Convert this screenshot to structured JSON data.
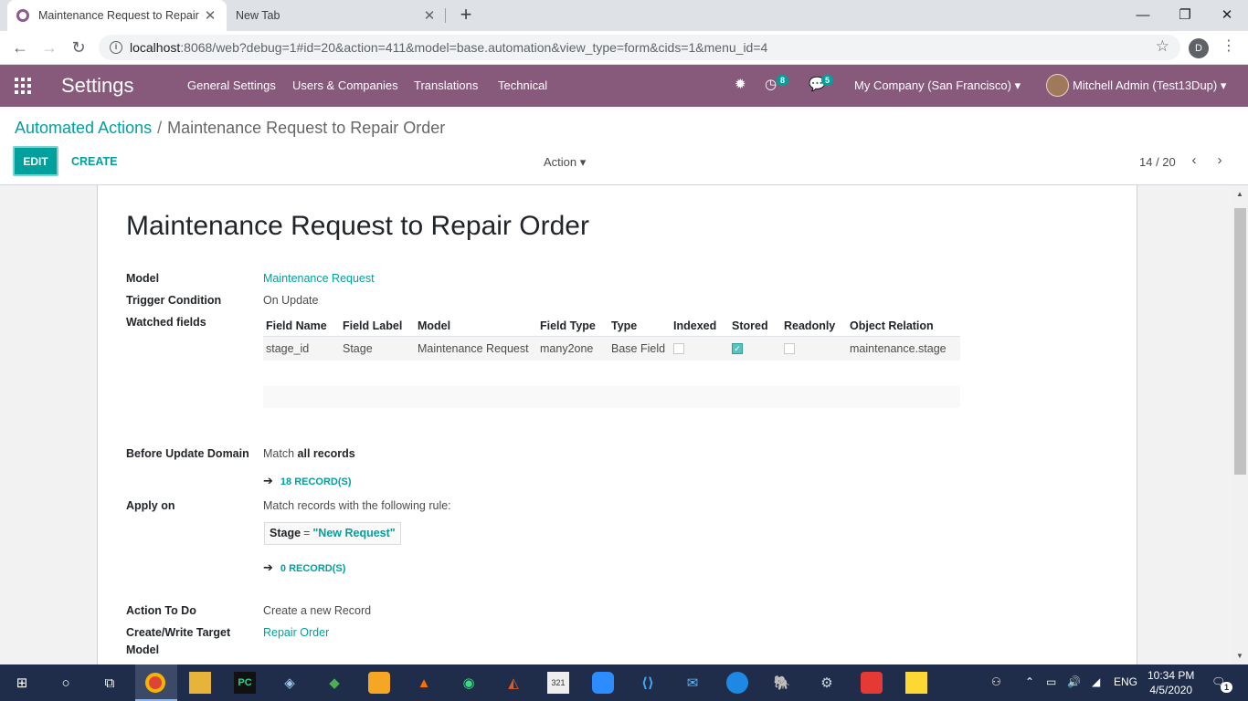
{
  "browser": {
    "active_tab_title": "Maintenance Request to Repair O",
    "inactive_tab_title": "New Tab",
    "url_host": "localhost",
    "url_rest": ":8068/web?debug=1#id=20&action=411&model=base.automation&view_type=form&cids=1&menu_id=4",
    "profile_initial": "D"
  },
  "navbar": {
    "brand": "Settings",
    "menus": [
      "General Settings",
      "Users & Companies",
      "Translations",
      "Technical"
    ],
    "activity_count": "8",
    "message_count": "5",
    "company": "My Company (San Francisco)",
    "user": "Mitchell Admin (Test13Dup)"
  },
  "control_panel": {
    "breadcrumb_parent": "Automated Actions",
    "breadcrumb_current": "Maintenance Request to Repair Order",
    "edit_label": "EDIT",
    "create_label": "CREATE",
    "action_label": "Action",
    "pager": "14 / 20"
  },
  "form": {
    "title": "Maintenance Request to Repair Order",
    "model_label": "Model",
    "model_value": "Maintenance Request",
    "trigger_label": "Trigger Condition",
    "trigger_value": "On Update",
    "watched_label": "Watched fields",
    "watched_headers": [
      "Field Name",
      "Field Label",
      "Model",
      "Field Type",
      "Type",
      "Indexed",
      "Stored",
      "Readonly",
      "Object Relation"
    ],
    "watched_row": {
      "field_name": "stage_id",
      "field_label": "Stage",
      "model": "Maintenance Request",
      "field_type": "many2one",
      "type": "Base Field",
      "indexed": false,
      "stored": true,
      "readonly": false,
      "relation": "maintenance.stage"
    },
    "before_label": "Before Update Domain",
    "before_match_prefix": "Match",
    "before_match_bold": "all records",
    "before_records": "18 RECORD(S)",
    "apply_label": "Apply on",
    "apply_text": "Match records with the following rule:",
    "rule_field": "Stage",
    "rule_op": "=",
    "rule_value": "\"New Request\"",
    "apply_records": "0 RECORD(S)",
    "action_label": "Action To Do",
    "action_value": "Create a new Record",
    "target_label_1": "Create/Write Target",
    "target_label_2": "Model",
    "target_value": "Repair Order"
  },
  "taskbar": {
    "lang": "ENG",
    "time": "10:34 PM",
    "date": "4/5/2020",
    "notif_count": "1"
  },
  "colors": {
    "navbar": "#875a7b",
    "accent": "#00a09d",
    "taskbar": "#1f2d4a"
  }
}
